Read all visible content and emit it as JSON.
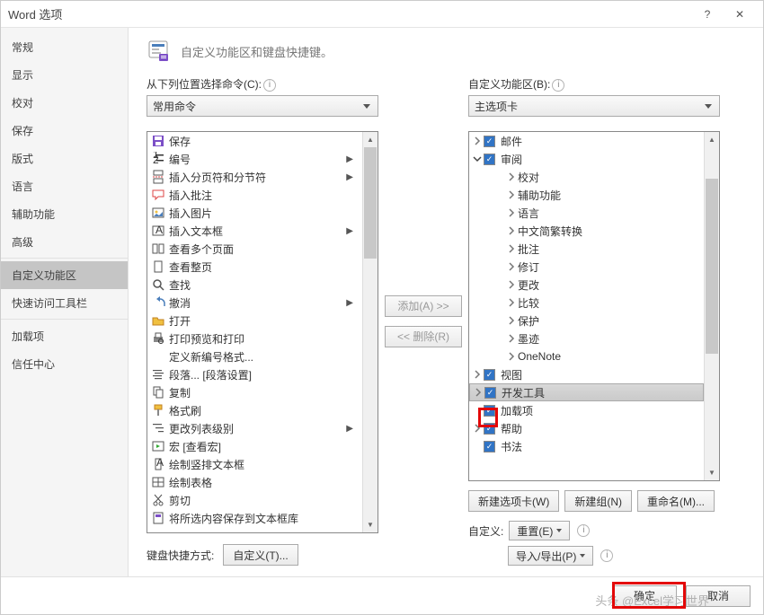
{
  "titlebar": {
    "title": "Word 选项",
    "help": "?",
    "close": "✕"
  },
  "sidebar": {
    "items": [
      {
        "label": "常规"
      },
      {
        "label": "显示"
      },
      {
        "label": "校对"
      },
      {
        "label": "保存"
      },
      {
        "label": "版式"
      },
      {
        "label": "语言"
      },
      {
        "label": "辅助功能"
      },
      {
        "label": "高级",
        "sep": true
      },
      {
        "label": "自定义功能区",
        "selected": true
      },
      {
        "label": "快速访问工具栏",
        "sep": true
      },
      {
        "label": "加载项"
      },
      {
        "label": "信任中心"
      }
    ]
  },
  "header": {
    "text": "自定义功能区和键盘快捷键。"
  },
  "left": {
    "label": "从下列位置选择命令(C):",
    "dropdown": "常用命令",
    "commands": [
      {
        "icon": "save",
        "label": "保存"
      },
      {
        "icon": "numbering",
        "label": "编号",
        "arrow": true
      },
      {
        "icon": "page-break",
        "label": "插入分页符和分节符",
        "arrow": true
      },
      {
        "icon": "comment",
        "label": "插入批注"
      },
      {
        "icon": "picture",
        "label": "插入图片"
      },
      {
        "icon": "textbox",
        "label": "插入文本框",
        "arrow": true
      },
      {
        "icon": "pages",
        "label": "查看多个页面"
      },
      {
        "icon": "page",
        "label": "查看整页"
      },
      {
        "icon": "search",
        "label": "查找"
      },
      {
        "icon": "undo",
        "label": "撤消",
        "arrow": true
      },
      {
        "icon": "open",
        "label": "打开"
      },
      {
        "icon": "print-preview",
        "label": "打印预览和打印"
      },
      {
        "icon": "blank",
        "label": "定义新编号格式..."
      },
      {
        "icon": "paragraph",
        "label": "段落... [段落设置]"
      },
      {
        "icon": "copy",
        "label": "复制"
      },
      {
        "icon": "format-painter",
        "label": "格式刷"
      },
      {
        "icon": "list-level",
        "label": "更改列表级别",
        "arrow": true
      },
      {
        "icon": "macro",
        "label": "宏 [查看宏]"
      },
      {
        "icon": "vertical-text",
        "label": "绘制竖排文本框"
      },
      {
        "icon": "table",
        "label": "绘制表格"
      },
      {
        "icon": "cut",
        "label": "剪切"
      },
      {
        "icon": "save-all",
        "label": "将所选内容保存到文本框库"
      }
    ],
    "keyboard": {
      "label": "键盘快捷方式:",
      "button": "自定义(T)..."
    }
  },
  "mid": {
    "add": "添加(A) >>",
    "remove": "<< 删除(R)"
  },
  "right": {
    "label": "自定义功能区(B):",
    "dropdown": "主选项卡",
    "tree": [
      {
        "type": "tab",
        "label": "邮件",
        "checked": true,
        "expanded": false,
        "indent": 0
      },
      {
        "type": "tab",
        "label": "审阅",
        "checked": true,
        "expanded": true,
        "indent": 0
      },
      {
        "type": "group",
        "label": "校对",
        "indent": 1
      },
      {
        "type": "group",
        "label": "辅助功能",
        "indent": 1
      },
      {
        "type": "group",
        "label": "语言",
        "indent": 1
      },
      {
        "type": "group",
        "label": "中文简繁转换",
        "indent": 1
      },
      {
        "type": "group",
        "label": "批注",
        "indent": 1
      },
      {
        "type": "group",
        "label": "修订",
        "indent": 1
      },
      {
        "type": "group",
        "label": "更改",
        "indent": 1
      },
      {
        "type": "group",
        "label": "比较",
        "indent": 1
      },
      {
        "type": "group",
        "label": "保护",
        "indent": 1
      },
      {
        "type": "group",
        "label": "墨迹",
        "indent": 1
      },
      {
        "type": "group",
        "label": "OneNote",
        "indent": 1
      },
      {
        "type": "tab",
        "label": "视图",
        "checked": true,
        "expanded": false,
        "indent": 0
      },
      {
        "type": "tab",
        "label": "开发工具",
        "checked": true,
        "expanded": false,
        "indent": 0,
        "selected": true
      },
      {
        "type": "tab",
        "label": "加载项",
        "checked": true,
        "expanded": false,
        "indent": 0,
        "noexp": true
      },
      {
        "type": "tab",
        "label": "帮助",
        "checked": true,
        "expanded": false,
        "indent": 0
      },
      {
        "type": "tab",
        "label": "书法",
        "checked": true,
        "expanded": false,
        "indent": 0,
        "noexp": true
      }
    ],
    "buttons": {
      "newtab": "新建选项卡(W)",
      "newgroup": "新建组(N)",
      "rename": "重命名(M)..."
    },
    "customize": {
      "label": "自定义:",
      "reset": "重置(E)",
      "importexport": "导入/导出(P)"
    }
  },
  "footer": {
    "ok": "确定",
    "cancel": "取消"
  },
  "watermark": "头条 @Excel学习世界"
}
